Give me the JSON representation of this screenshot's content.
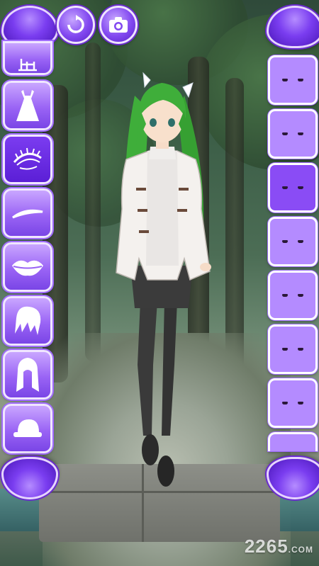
{
  "top_bar": {
    "left_arrow_icon": "triangle-up-icon",
    "refresh_icon": "refresh-icon",
    "camera_icon": "camera-icon",
    "right_arrow_icon": "triangle-up-icon"
  },
  "left_categories": [
    {
      "id": "accessory",
      "icon": "hanger-icon"
    },
    {
      "id": "dress",
      "icon": "dress-icon"
    },
    {
      "id": "eyes",
      "icon": "eyelash-icon",
      "selected": true
    },
    {
      "id": "eyebrows",
      "icon": "eyebrow-icon"
    },
    {
      "id": "lips",
      "icon": "lips-icon"
    },
    {
      "id": "bangs",
      "icon": "bangs-hair-icon"
    },
    {
      "id": "hair",
      "icon": "long-hair-icon"
    },
    {
      "id": "hat",
      "icon": "hat-icon"
    }
  ],
  "right_options": [
    {
      "id": "eye-1"
    },
    {
      "id": "eye-2"
    },
    {
      "id": "eye-3",
      "selected": true
    },
    {
      "id": "eye-4"
    },
    {
      "id": "eye-5"
    },
    {
      "id": "eye-6"
    },
    {
      "id": "eye-7"
    },
    {
      "id": "eye-8"
    }
  ],
  "colors": {
    "accent": "#7a3df0",
    "tile_border": "#f0e6ff",
    "hair": "#3fae3a"
  },
  "watermark": {
    "main": "2265",
    "suffix": ".COM"
  }
}
